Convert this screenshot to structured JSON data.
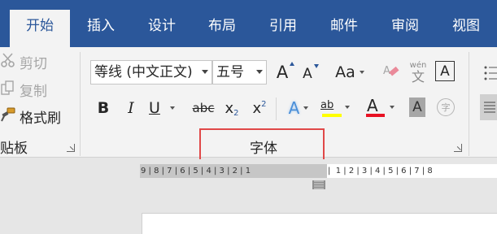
{
  "tabs": [
    {
      "label": "开始",
      "active": true
    },
    {
      "label": "插入"
    },
    {
      "label": "设计"
    },
    {
      "label": "布局"
    },
    {
      "label": "引用"
    },
    {
      "label": "邮件"
    },
    {
      "label": "审阅"
    },
    {
      "label": "视图"
    }
  ],
  "clipboard": {
    "cut_label": "剪切",
    "copy_label": "复制",
    "format_painter_label": "格式刷",
    "group_label": "贴板"
  },
  "font": {
    "font_name": "等线 (中文正文)",
    "font_size": "五号",
    "grow_glyph": "A",
    "shrink_glyph": "A",
    "case_glyph": "Aa",
    "phonetic_top": "wén",
    "phonetic_bottom": "文",
    "border_glyph": "A",
    "bold": "B",
    "italic": "I",
    "underline": "U",
    "strike": "abc",
    "subscript": "x",
    "subscript_mark": "2",
    "superscript": "x",
    "superscript_mark": "2",
    "effects_glyph": "A",
    "highlight_glyph": "ab",
    "color_glyph": "A",
    "shading_glyph": "A",
    "enclose_glyph": "字",
    "group_label": "字体",
    "highlight_color": "#ffff00",
    "font_color": "#e81123"
  },
  "ruler": {
    "left_text": "9 | 8 | 7 | 6 | 5 | 4 | 3 | 2 | 1",
    "right_text": "|  1 | 2 | 3 | 4 | 5 | 6 | 7 | 8"
  },
  "colors": {
    "accent": "#2b579a",
    "highlight_box": "#e04848"
  }
}
